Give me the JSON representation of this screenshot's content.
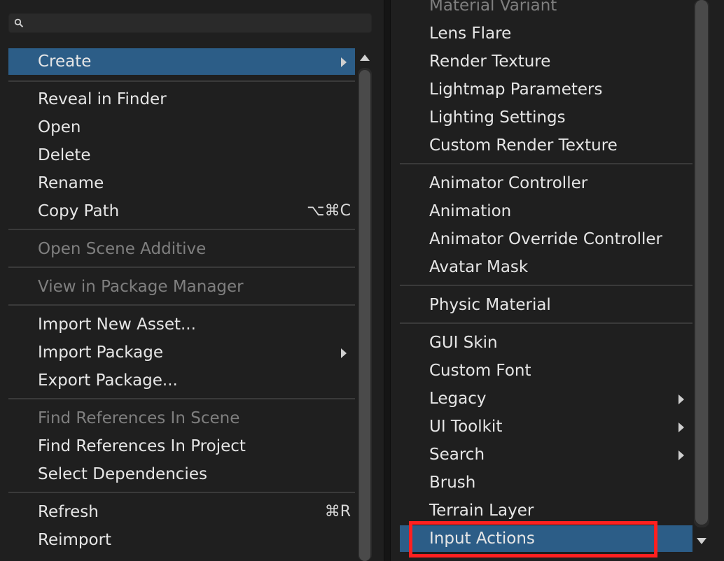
{
  "left_menu": {
    "search": {
      "value": "",
      "placeholder": ""
    },
    "items": [
      {
        "label": "Create",
        "selected": true,
        "submenu": true
      },
      {
        "label": "Reveal in Finder"
      },
      {
        "label": "Open"
      },
      {
        "label": "Delete"
      },
      {
        "label": "Rename"
      },
      {
        "label": "Copy Path",
        "shortcut": "⌥⌘C"
      },
      {
        "label": "Open Scene Additive",
        "disabled": true
      },
      {
        "label": "View in Package Manager",
        "disabled": true
      },
      {
        "label": "Import New Asset..."
      },
      {
        "label": "Import Package",
        "submenu": true
      },
      {
        "label": "Export Package..."
      },
      {
        "label": "Find References In Scene",
        "disabled": true
      },
      {
        "label": "Find References In Project"
      },
      {
        "label": "Select Dependencies"
      },
      {
        "label": "Refresh",
        "shortcut": "⌘R"
      },
      {
        "label": "Reimport"
      }
    ]
  },
  "right_menu": {
    "items": [
      {
        "label": "Material Variant",
        "disabled": true
      },
      {
        "label": "Lens Flare"
      },
      {
        "label": "Render Texture"
      },
      {
        "label": "Lightmap Parameters"
      },
      {
        "label": "Lighting Settings"
      },
      {
        "label": "Custom Render Texture"
      },
      {
        "label": "Animator Controller"
      },
      {
        "label": "Animation"
      },
      {
        "label": "Animator Override Controller"
      },
      {
        "label": "Avatar Mask"
      },
      {
        "label": "Physic Material"
      },
      {
        "label": "GUI Skin"
      },
      {
        "label": "Custom Font"
      },
      {
        "label": "Legacy",
        "submenu": true
      },
      {
        "label": "UI Toolkit",
        "submenu": true
      },
      {
        "label": "Search",
        "submenu": true
      },
      {
        "label": "Brush"
      },
      {
        "label": "Terrain Layer"
      },
      {
        "label": "Input Actions",
        "selected": true,
        "highlighted": true
      }
    ]
  },
  "colors": {
    "menu_bg": "#1f1f1f",
    "selected_bg": "#2c5d87",
    "highlight_outline": "#ff2020",
    "disabled_text": "#7f7f7f"
  },
  "icons": {
    "search": "search-icon",
    "submenu": "chevron-right-icon"
  }
}
